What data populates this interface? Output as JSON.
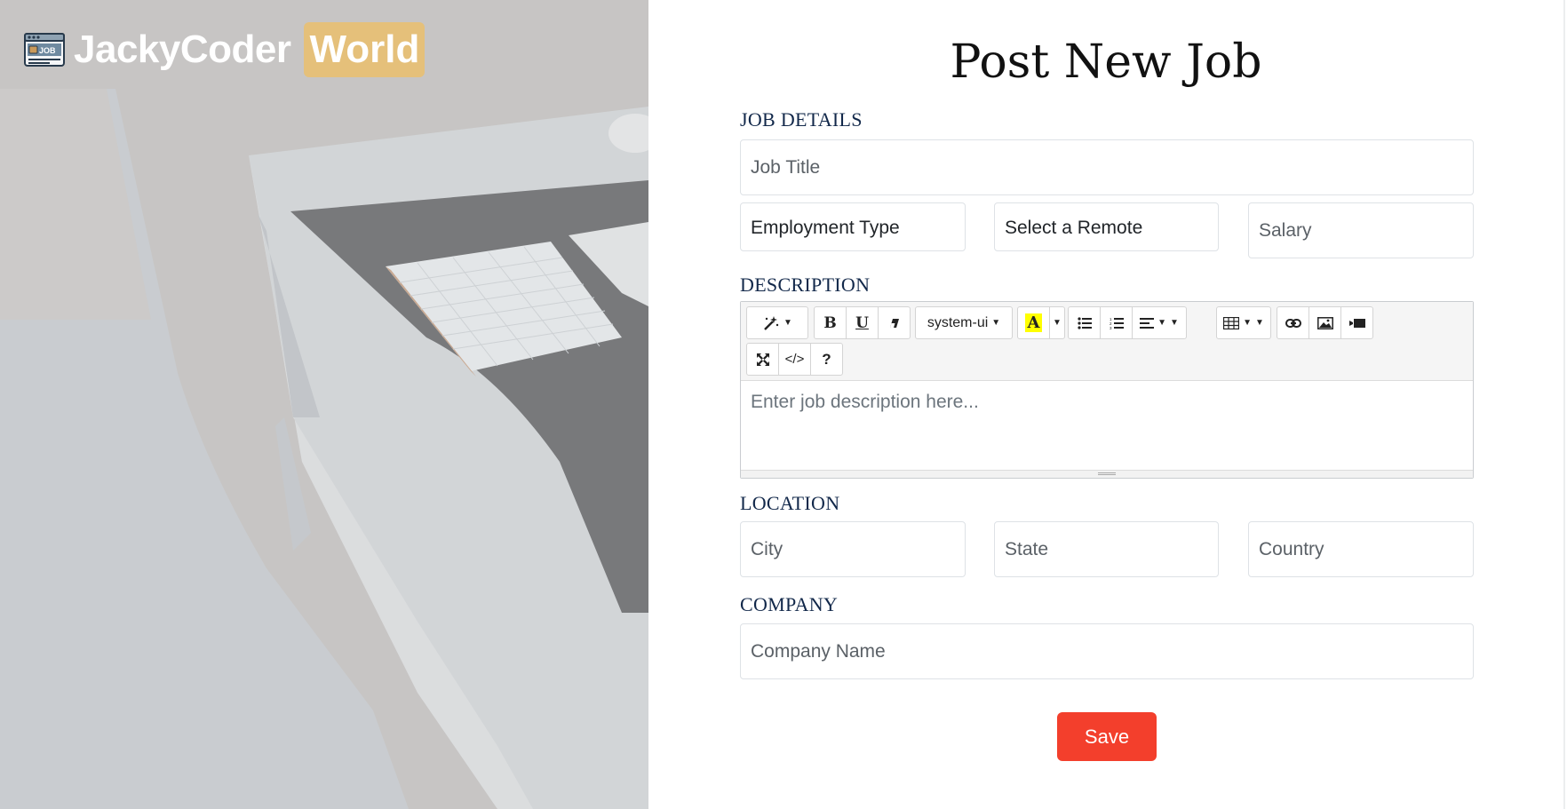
{
  "brand": {
    "icon": "job-browser-icon",
    "icon_text": "JOB",
    "name": "JackyCoder",
    "highlight": "World",
    "highlight_color": "#e5c07a"
  },
  "form": {
    "title": "Post New Job",
    "sections": {
      "job_details": "JOB DETAILS",
      "description": "DESCRIPTION",
      "location": "LOCATION",
      "company": "COMPANY"
    },
    "job_title_placeholder": "Job Title",
    "employment_type": "Employment Type",
    "remote": "Select a Remote",
    "salary_placeholder": "Salary",
    "city_placeholder": "City",
    "state_placeholder": "State",
    "country_placeholder": "Country",
    "company_name_placeholder": "Company Name",
    "save_label": "Save",
    "accent_color": "#f33f2c"
  },
  "editor": {
    "font_name": "system-ui",
    "placeholder": "Enter job description here...",
    "toolbar_icons": [
      "magic-style-icon",
      "bold-icon",
      "underline-icon",
      "eraser-icon",
      "font-name-dropdown",
      "text-color-icon",
      "unordered-list-icon",
      "ordered-list-icon",
      "align-icon",
      "table-icon",
      "link-icon",
      "picture-icon",
      "video-icon",
      "fullscreen-icon",
      "code-view-icon",
      "help-icon"
    ]
  }
}
